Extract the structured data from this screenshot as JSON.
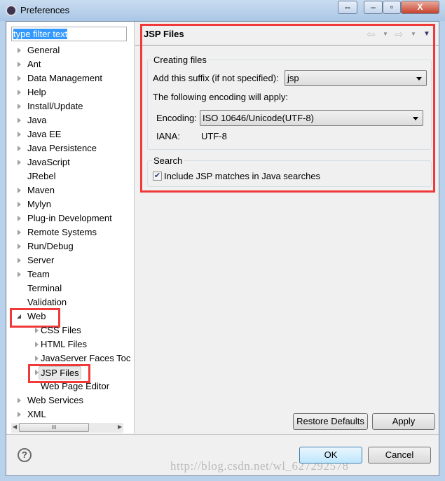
{
  "window": {
    "title": "Preferences",
    "restore_symbol": "⇔",
    "minimize_symbol": "–",
    "maximize_symbol": "▫",
    "close_symbol": "X"
  },
  "filter": {
    "value": "type filter text"
  },
  "tree": [
    {
      "label": "General",
      "arrow": true,
      "level": 0
    },
    {
      "label": "Ant",
      "arrow": true,
      "level": 0
    },
    {
      "label": "Data Management",
      "arrow": true,
      "level": 0
    },
    {
      "label": "Help",
      "arrow": true,
      "level": 0
    },
    {
      "label": "Install/Update",
      "arrow": true,
      "level": 0
    },
    {
      "label": "Java",
      "arrow": true,
      "level": 0
    },
    {
      "label": "Java EE",
      "arrow": true,
      "level": 0
    },
    {
      "label": "Java Persistence",
      "arrow": true,
      "level": 0
    },
    {
      "label": "JavaScript",
      "arrow": true,
      "level": 0
    },
    {
      "label": "JRebel",
      "arrow": false,
      "level": 0
    },
    {
      "label": "Maven",
      "arrow": true,
      "level": 0
    },
    {
      "label": "Mylyn",
      "arrow": true,
      "level": 0
    },
    {
      "label": "Plug-in Development",
      "arrow": true,
      "level": 0
    },
    {
      "label": "Remote Systems",
      "arrow": true,
      "level": 0
    },
    {
      "label": "Run/Debug",
      "arrow": true,
      "level": 0
    },
    {
      "label": "Server",
      "arrow": true,
      "level": 0
    },
    {
      "label": "Team",
      "arrow": true,
      "level": 0
    },
    {
      "label": "Terminal",
      "arrow": false,
      "level": 0
    },
    {
      "label": "Validation",
      "arrow": false,
      "level": 0
    },
    {
      "label": "Web",
      "arrow": true,
      "open": true,
      "level": 0,
      "highlight": true
    },
    {
      "label": "CSS Files",
      "arrow": true,
      "level": 1
    },
    {
      "label": "HTML Files",
      "arrow": true,
      "level": 1
    },
    {
      "label": "JavaServer Faces Toc",
      "arrow": true,
      "level": 1
    },
    {
      "label": "JSP Files",
      "arrow": true,
      "level": 1,
      "selected": true,
      "highlight": true
    },
    {
      "label": "Web Page Editor",
      "arrow": false,
      "level": 1
    },
    {
      "label": "Web Services",
      "arrow": true,
      "level": 0
    },
    {
      "label": "XML",
      "arrow": true,
      "level": 0
    }
  ],
  "scrollbar": {
    "thumb_grip": "III"
  },
  "page": {
    "title": "JSP Files",
    "creating_group": "Creating files",
    "suffix_label": "Add this suffix (if not specified):",
    "suffix_value": "jsp",
    "encoding_note": "The following encoding will apply:",
    "encoding_label": "Encoding:",
    "encoding_value": "ISO 10646/Unicode(UTF-8)",
    "iana_label": "IANA:",
    "iana_value": "UTF-8",
    "search_group": "Search",
    "include_jsp_label": "Include JSP matches in Java searches",
    "include_jsp_checked": true
  },
  "buttons": {
    "restore_defaults": "Restore Defaults",
    "apply": "Apply",
    "ok": "OK",
    "cancel": "Cancel",
    "help": "?"
  },
  "watermark": "http://blog.csdn.net/wl_627292578",
  "colors": {
    "highlight": "#f03a3a",
    "selection": "#3399ff"
  }
}
